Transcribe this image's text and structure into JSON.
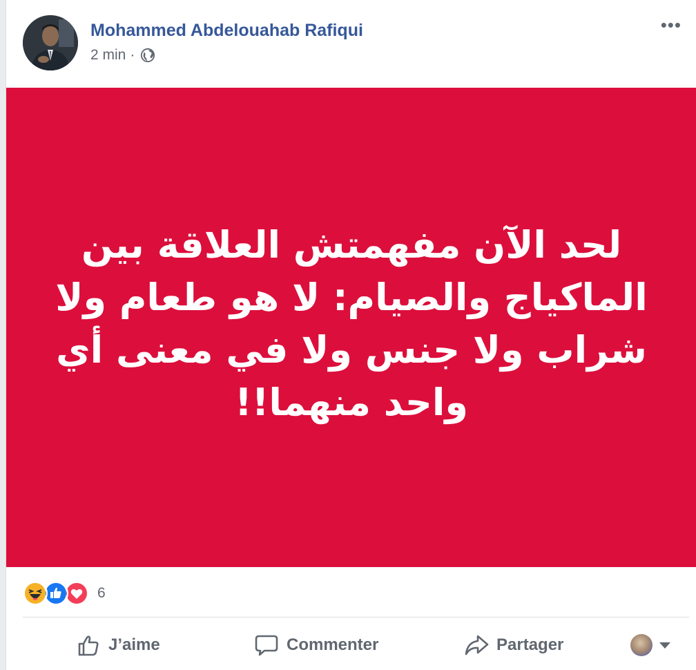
{
  "post": {
    "author_name": "Mohammed Abdelouahab Rafiqui",
    "timestamp": "2 min",
    "separator": "·",
    "audience_icon": "globe-icon",
    "more_label": "•••",
    "image_text": "لحد الآن مفهمتش العلاقة بين الماكياج والصيام: لا هو طعام ولا شراب ولا جنس ولا في معنى أي واحد منهما!!",
    "image_background": "#dc0f3c"
  },
  "reactions": {
    "icons": [
      "haha-icon",
      "like-icon",
      "love-icon"
    ],
    "count": "6"
  },
  "actions": {
    "like_label": "J’aime",
    "comment_label": "Commenter",
    "share_label": "Partager"
  },
  "colors": {
    "author": "#365899",
    "like_blue": "#1877f2",
    "love_red": "#f33e58",
    "haha_yellow": "#f7b125"
  }
}
